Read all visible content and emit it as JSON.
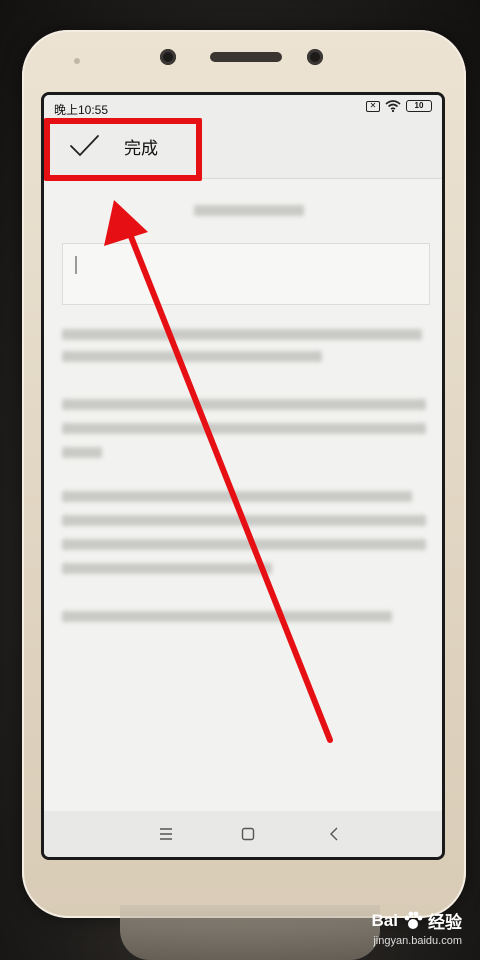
{
  "status_bar": {
    "time": "晚上10:55",
    "sim_icon": "sim-x-icon",
    "battery": "10"
  },
  "toolbar": {
    "done_label": "完成",
    "done_icon": "check-icon"
  },
  "nav_bar": {
    "items": [
      "menu-icon",
      "home-icon",
      "back-icon"
    ]
  },
  "annotation": {
    "highlight_color": "#e60f14",
    "arrow_color": "#e60f14"
  },
  "watermark": {
    "brand": "Bai",
    "brand_suffix": "经验",
    "url": "jingyan.baidu.com"
  }
}
